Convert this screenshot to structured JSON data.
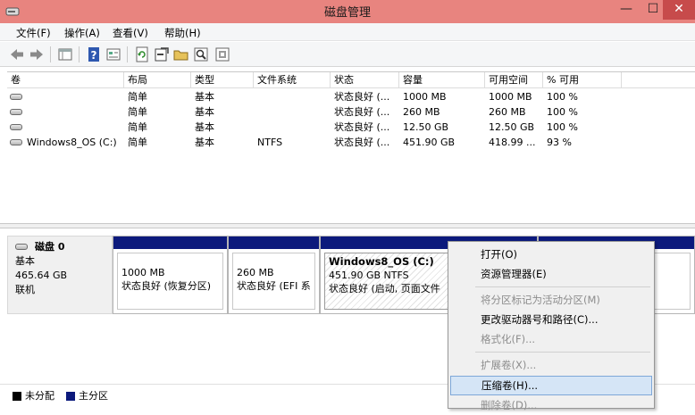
{
  "window": {
    "title": "磁盘管理",
    "minimize_glyph": "—",
    "maximize_glyph": "☐",
    "close_glyph": "✕"
  },
  "menubar": {
    "items": [
      "文件(F)",
      "操作(A)",
      "查看(V)",
      "帮助(H)"
    ]
  },
  "toolbar": {
    "icons": [
      "back-arrow-icon",
      "forward-arrow-icon",
      "volume-list-icon",
      "help-icon",
      "properties-icon",
      "refresh-icon",
      "rescan-icon",
      "open-folder-icon",
      "magnifier-icon",
      "settings-icon"
    ]
  },
  "volume_table": {
    "columns": [
      "卷",
      "布局",
      "类型",
      "文件系统",
      "状态",
      "容量",
      "可用空间",
      "% 可用"
    ],
    "rows": [
      {
        "volume": "",
        "layout": "简单",
        "type": "基本",
        "fs": "",
        "status": "状态良好 (...",
        "capacity": "1000 MB",
        "free": "1000 MB",
        "pct": "100 %"
      },
      {
        "volume": "",
        "layout": "简单",
        "type": "基本",
        "fs": "",
        "status": "状态良好 (...",
        "capacity": "260 MB",
        "free": "260 MB",
        "pct": "100 %"
      },
      {
        "volume": "",
        "layout": "简单",
        "type": "基本",
        "fs": "",
        "status": "状态良好 (...",
        "capacity": "12.50 GB",
        "free": "12.50 GB",
        "pct": "100 %"
      },
      {
        "volume": "Windows8_OS (C:)",
        "layout": "简单",
        "type": "基本",
        "fs": "NTFS",
        "status": "状态良好 (...",
        "capacity": "451.90 GB",
        "free": "418.99 ...",
        "pct": "93 %"
      }
    ]
  },
  "disk": {
    "name": "磁盘 0",
    "type": "基本",
    "size": "465.64 GB",
    "state": "联机",
    "partitions": [
      {
        "title": "",
        "line1": "1000 MB",
        "line2": "状态良好 (恢复分区)"
      },
      {
        "title": "",
        "line1": "260 MB",
        "line2": "状态良好 (EFI 系"
      },
      {
        "title": "Windows8_OS  (C:)",
        "line1": "451.90 GB NTFS",
        "line2": "状态良好 (启动, 页面文件"
      },
      {
        "title": "",
        "line1": "",
        "line2": ""
      }
    ]
  },
  "legend": {
    "unallocated": "未分配",
    "primary": "主分区",
    "unallocated_color": "#000000",
    "primary_color": "#0c1a7c"
  },
  "context_menu": {
    "items": [
      {
        "label": "打开(O)",
        "enabled": true
      },
      {
        "label": "资源管理器(E)",
        "enabled": true
      },
      {
        "label": "将分区标记为活动分区(M)",
        "enabled": false
      },
      {
        "label": "更改驱动器号和路径(C)...",
        "enabled": true
      },
      {
        "label": "格式化(F)...",
        "enabled": false
      },
      {
        "label": "扩展卷(X)...",
        "enabled": false
      },
      {
        "label": "压缩卷(H)...",
        "enabled": true,
        "highlighted": true
      },
      {
        "label": "删除卷(D)...",
        "enabled": false
      }
    ]
  }
}
